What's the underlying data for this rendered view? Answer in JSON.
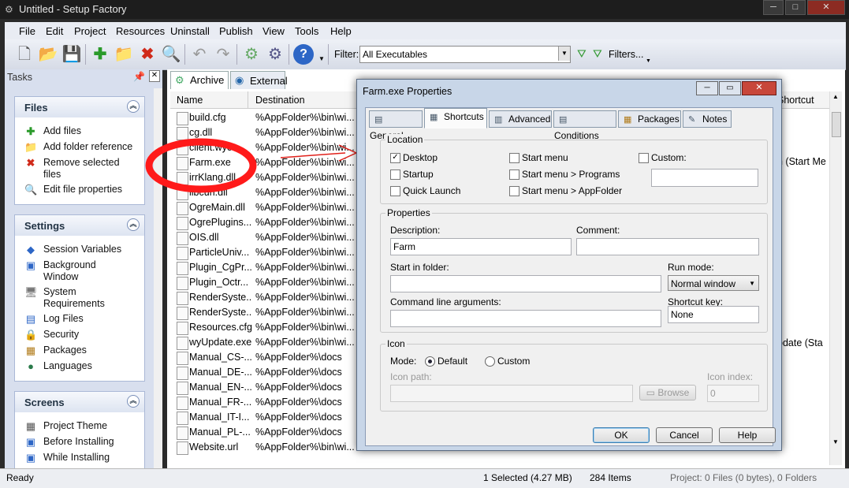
{
  "window": {
    "title": "Untitled - Setup Factory"
  },
  "menu": [
    "File",
    "Edit",
    "Project",
    "Resources",
    "Uninstall",
    "Publish",
    "View",
    "Tools",
    "Help"
  ],
  "toolbar": {
    "filter_label": "Filter:",
    "filter_value": "All Executables",
    "filters_button": "Filters..."
  },
  "tasks": {
    "title": "Tasks",
    "files": {
      "title": "Files",
      "items": [
        "Add files",
        "Add folder reference",
        "Remove selected files",
        "Edit file properties"
      ]
    },
    "settings": {
      "title": "Settings",
      "items": [
        "Session Variables",
        "Background Window",
        "System Requirements",
        "Log Files",
        "Security",
        "Packages",
        "Languages"
      ]
    },
    "screens": {
      "title": "Screens",
      "items": [
        "Project Theme",
        "Before Installing",
        "While Installing"
      ]
    }
  },
  "center": {
    "tabs": [
      "Archive",
      "External"
    ],
    "columns": [
      "Name",
      "Destination",
      "Shortcut"
    ],
    "rows": [
      {
        "name": "build.cfg",
        "dest": "%AppFolder%\\bin\\wi..."
      },
      {
        "name": "cg.dll",
        "dest": "%AppFolder%\\bin\\wi..."
      },
      {
        "name": "client.wyc",
        "dest": "%AppFolder%\\bin\\wi..."
      },
      {
        "name": "Farm.exe",
        "dest": "%AppFolder%\\bin\\wi..."
      },
      {
        "name": "irrKlang.dll",
        "dest": "%AppFolder%\\bin\\wi..."
      },
      {
        "name": "libcurl.dll",
        "dest": "%AppFolder%\\bin\\wi..."
      },
      {
        "name": "OgreMain.dll",
        "dest": "%AppFolder%\\bin\\wi..."
      },
      {
        "name": "OgrePlugins...",
        "dest": "%AppFolder%\\bin\\wi..."
      },
      {
        "name": "OIS.dll",
        "dest": "%AppFolder%\\bin\\wi..."
      },
      {
        "name": "ParticleUniv...",
        "dest": "%AppFolder%\\bin\\wi..."
      },
      {
        "name": "Plugin_CgPr...",
        "dest": "%AppFolder%\\bin\\wi..."
      },
      {
        "name": "Plugin_Octr...",
        "dest": "%AppFolder%\\bin\\wi..."
      },
      {
        "name": "RenderSyste...",
        "dest": "%AppFolder%\\bin\\wi..."
      },
      {
        "name": "RenderSyste...",
        "dest": "%AppFolder%\\bin\\wi..."
      },
      {
        "name": "Resources.cfg",
        "dest": "%AppFolder%\\bin\\wi..."
      },
      {
        "name": "wyUpdate.exe",
        "dest": "%AppFolder%\\bin\\wi..."
      },
      {
        "name": "Manual_CS-...",
        "dest": "%AppFolder%\\docs"
      },
      {
        "name": "Manual_DE-...",
        "dest": "%AppFolder%\\docs"
      },
      {
        "name": "Manual_EN-...",
        "dest": "%AppFolder%\\docs"
      },
      {
        "name": "Manual_FR-...",
        "dest": "%AppFolder%\\docs"
      },
      {
        "name": "Manual_IT-I...",
        "dest": "%AppFolder%\\docs"
      },
      {
        "name": "Manual_PL-...",
        "dest": "%AppFolder%\\docs"
      },
      {
        "name": "Website.url",
        "dest": "%AppFolder%\\bin\\wi..."
      }
    ],
    "right_snippets": [
      "n (Start Me",
      "pdate (Sta"
    ]
  },
  "status": {
    "ready": "Ready",
    "selected": "1 Selected (4.27 MB)",
    "items": "284 Items",
    "project": "Project: 0 Files (0 bytes), 0 Folders"
  },
  "dialog": {
    "title": "Farm.exe Properties",
    "tabs": [
      "General",
      "Shortcuts",
      "Advanced",
      "Conditions",
      "Packages",
      "Notes"
    ],
    "location": {
      "title": "Location",
      "desktop": "Desktop",
      "startup": "Startup",
      "quicklaunch": "Quick Launch",
      "startmenu": "Start menu",
      "startmenu_programs": "Start menu > Programs",
      "startmenu_appfolder": "Start menu > AppFolder",
      "custom": "Custom:"
    },
    "properties": {
      "title": "Properties",
      "description_label": "Description:",
      "description_value": "Farm",
      "comment_label": "Comment:",
      "startin_label": "Start in folder:",
      "runmode_label": "Run mode:",
      "runmode_value": "Normal window",
      "cmdline_label": "Command line arguments:",
      "shortcut_label": "Shortcut key:",
      "shortcut_value": "None"
    },
    "icon": {
      "title": "Icon",
      "mode_label": "Mode:",
      "default": "Default",
      "custom": "Custom",
      "path_label": "Icon path:",
      "browse": "Browse",
      "index_label": "Icon index:",
      "index_value": "0"
    },
    "buttons": {
      "ok": "OK",
      "cancel": "Cancel",
      "help": "Help"
    }
  }
}
